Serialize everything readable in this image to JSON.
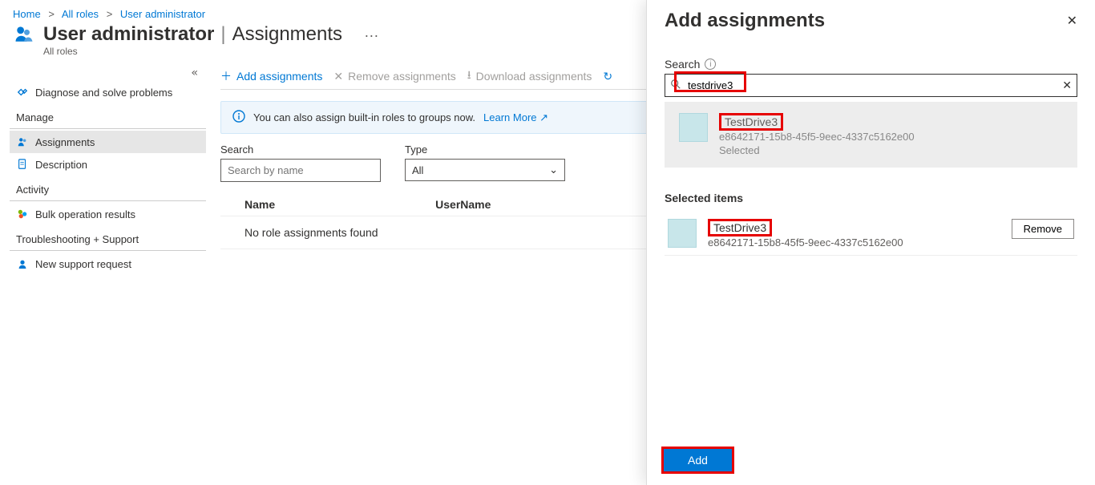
{
  "breadcrumb": {
    "home": "Home",
    "all_roles": "All roles",
    "current": "User administrator"
  },
  "header": {
    "title_main": "User administrator",
    "title_section": "Assignments",
    "subtitle": "All roles",
    "more": "···"
  },
  "sidebar": {
    "collapse": "«",
    "item_diagnose": "Diagnose and solve problems",
    "section_manage": "Manage",
    "item_assignments": "Assignments",
    "item_description": "Description",
    "section_activity": "Activity",
    "item_bulk": "Bulk operation results",
    "section_troubleshoot": "Troubleshooting + Support",
    "item_support": "New support request"
  },
  "toolbar": {
    "add": "Add assignments",
    "remove": "Remove assignments",
    "download": "Download assignments"
  },
  "banner": {
    "text": "You can also assign built-in roles to groups now.",
    "learn": "Learn More"
  },
  "filters": {
    "search_label": "Search",
    "search_placeholder": "Search by name",
    "type_label": "Type",
    "type_value": "All"
  },
  "table": {
    "col_name": "Name",
    "col_user": "UserName",
    "empty": "No role assignments found"
  },
  "flyout": {
    "title": "Add assignments",
    "search_label": "Search",
    "search_value": "testdrive3",
    "result": {
      "name": "TestDrive3",
      "id": "e8642171-15b8-45f5-9eec-4337c5162e00",
      "status": "Selected"
    },
    "selected_header": "Selected items",
    "selected_item": {
      "name": "TestDrive3",
      "id": "e8642171-15b8-45f5-9eec-4337c5162e00"
    },
    "remove": "Remove",
    "add_button": "Add"
  }
}
